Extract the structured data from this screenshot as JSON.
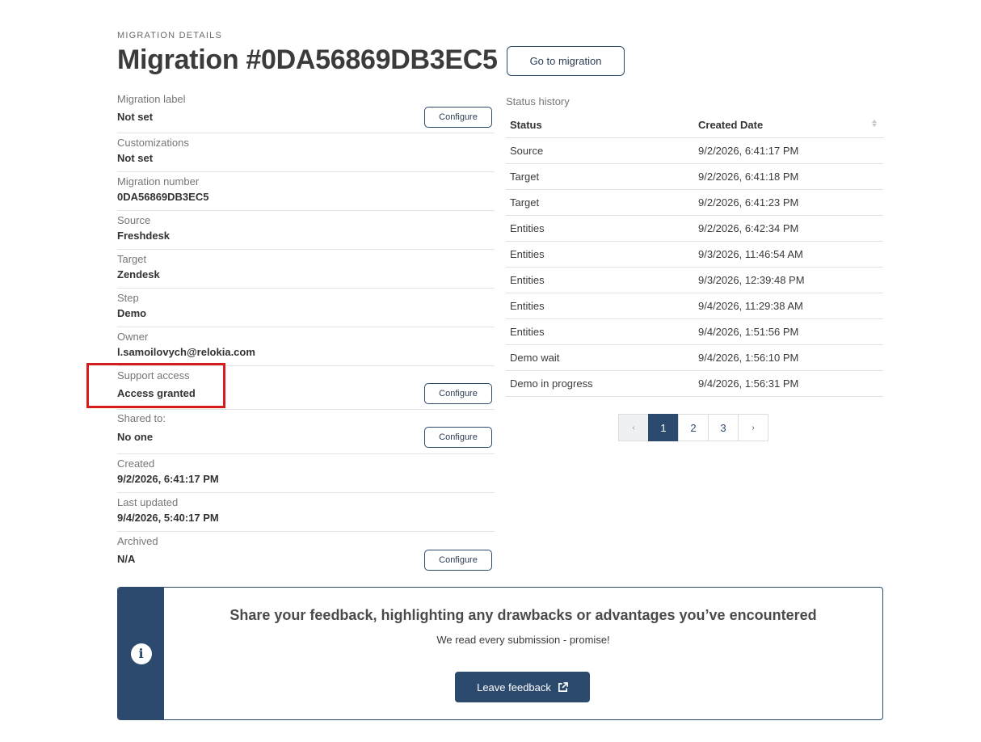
{
  "header": {
    "eyebrow": "MIGRATION DETAILS",
    "title": "Migration #0DA56869DB3EC5",
    "goto_button": "Go to migration"
  },
  "details": {
    "configure_label": "Configure",
    "rows": [
      {
        "label": "Migration label",
        "value": "Not set"
      },
      {
        "label": "Customizations",
        "value": "Not set"
      },
      {
        "label": "Migration number",
        "value": "0DA56869DB3EC5"
      },
      {
        "label": "Source",
        "value": "Freshdesk"
      },
      {
        "label": "Target",
        "value": "Zendesk"
      },
      {
        "label": "Step",
        "value": "Demo"
      },
      {
        "label": "Owner",
        "value": "l.samoilovych@relokia.com"
      },
      {
        "label": "Support access",
        "value": "Access granted"
      },
      {
        "label": "Shared to:",
        "value": "No one"
      },
      {
        "label": "Created",
        "value": "9/2/2026, 6:41:17 PM"
      },
      {
        "label": "Last updated",
        "value": "9/4/2026, 5:40:17 PM"
      },
      {
        "label": "Archived",
        "value": "N/A"
      }
    ]
  },
  "status_history": {
    "label": "Status history",
    "columns": [
      "Status",
      "Created Date"
    ],
    "rows": [
      [
        "Source",
        "9/2/2026, 6:41:17 PM"
      ],
      [
        "Target",
        "9/2/2026, 6:41:18 PM"
      ],
      [
        "Target",
        "9/2/2026, 6:41:23 PM"
      ],
      [
        "Entities",
        "9/2/2026, 6:42:34 PM"
      ],
      [
        "Entities",
        "9/3/2026, 11:46:54 AM"
      ],
      [
        "Entities",
        "9/3/2026, 12:39:48 PM"
      ],
      [
        "Entities",
        "9/4/2026, 11:29:38 AM"
      ],
      [
        "Entities",
        "9/4/2026, 1:51:56 PM"
      ],
      [
        "Demo wait",
        "9/4/2026, 1:56:10 PM"
      ],
      [
        "Demo in progress",
        "9/4/2026, 1:56:31 PM"
      ]
    ],
    "pagination": {
      "prev": "‹",
      "pages": [
        "1",
        "2",
        "3"
      ],
      "next": "›",
      "current": "1"
    }
  },
  "feedback": {
    "title": "Share your feedback, highlighting any drawbacks or advantages you’ve encountered",
    "subtitle": "We read every submission - promise!",
    "button": "Leave feedback",
    "icon": "info-icon"
  },
  "colors": {
    "primary": "#2c4a6e",
    "highlight": "#d61c1c"
  }
}
